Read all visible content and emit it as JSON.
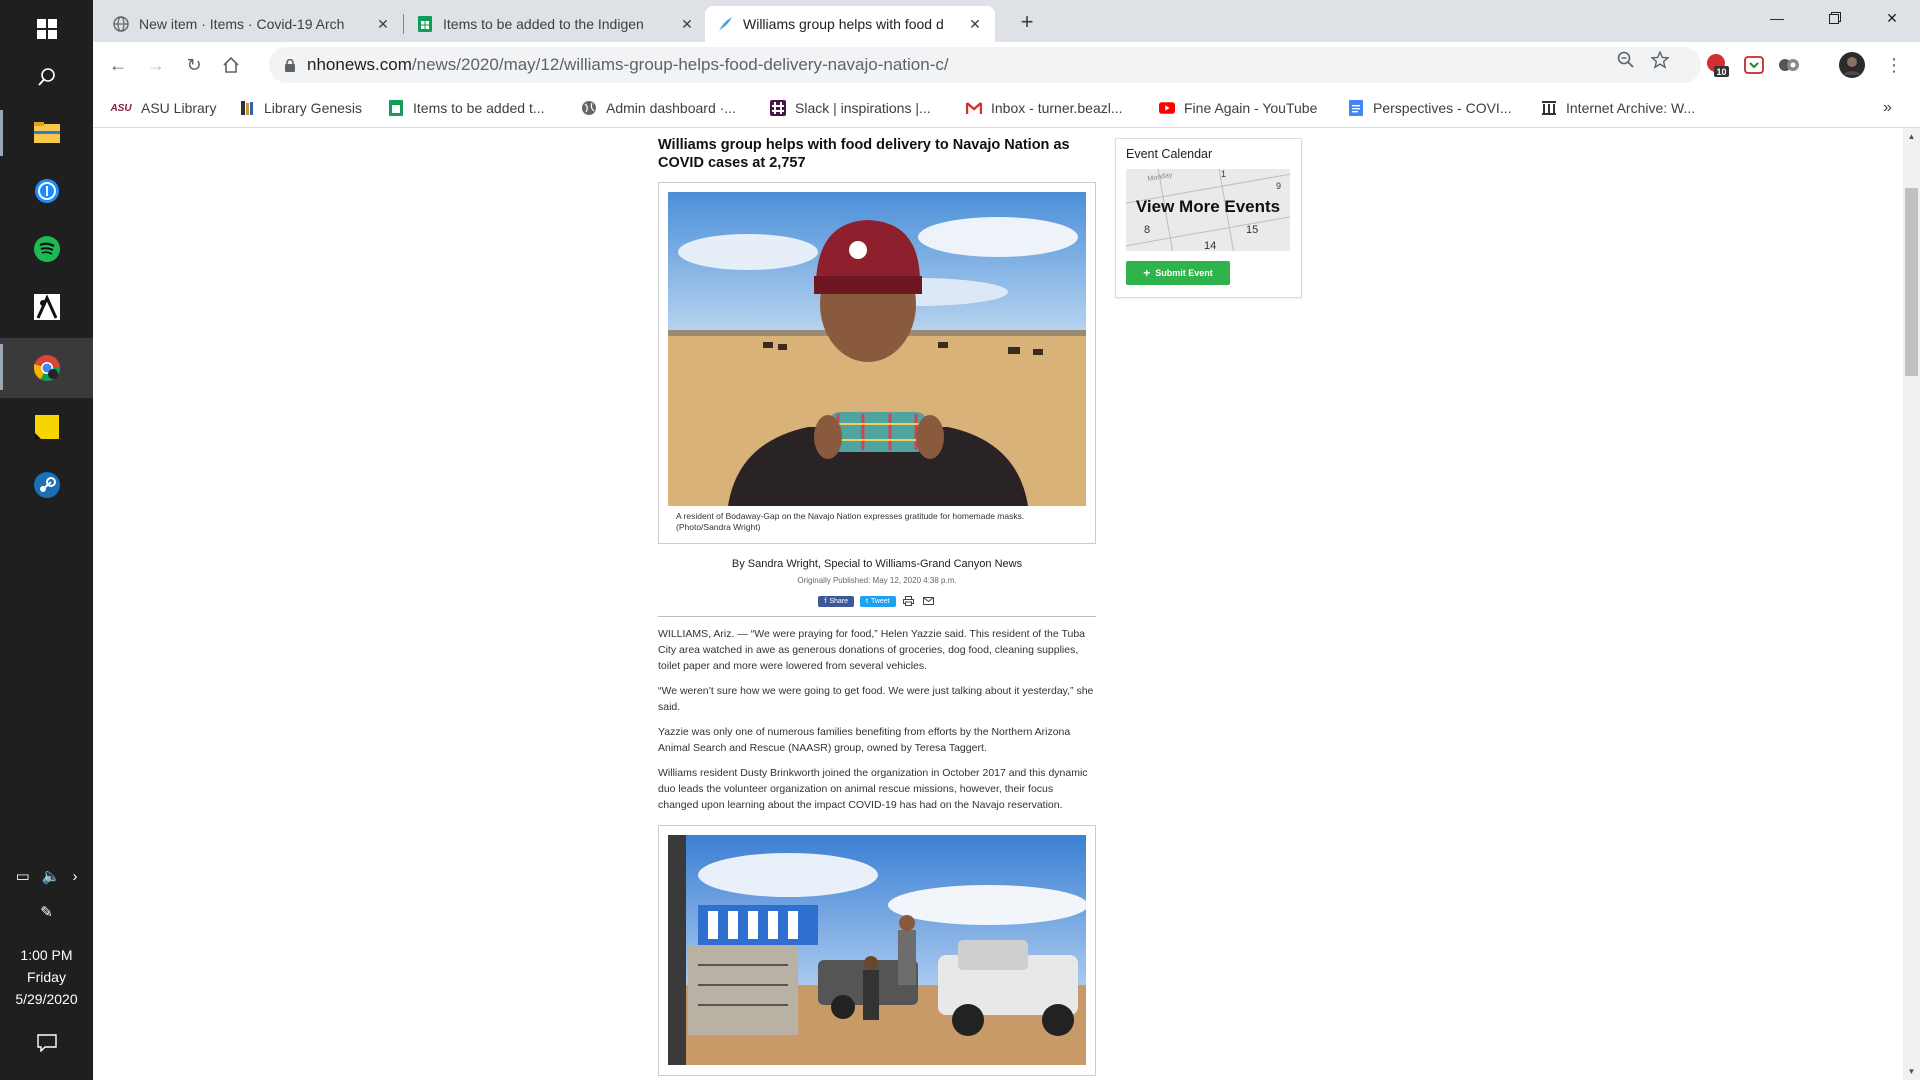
{
  "taskbar": {
    "time": "1:00 PM",
    "day": "Friday",
    "date": "5/29/2020"
  },
  "tabs": [
    {
      "title": "New item · Items · Covid-19 Arch",
      "icon": "globe-icon"
    },
    {
      "title": "Items to be added to the Indigen",
      "icon": "sheets-icon"
    },
    {
      "title": "Williams group helps with food d",
      "icon": "quill-icon"
    }
  ],
  "toolbar": {
    "url_host": "nhonews.com",
    "url_path": "/news/2020/may/12/williams-group-helps-food-delivery-navajo-nation-c/",
    "ext_badge": "10"
  },
  "bookmarks": [
    {
      "label": "ASU Library",
      "icon": "asu-icon"
    },
    {
      "label": "Library Genesis",
      "icon": "library-icon"
    },
    {
      "label": "Items to be added t...",
      "icon": "sheets-icon"
    },
    {
      "label": "Admin dashboard ·...",
      "icon": "globe-icon"
    },
    {
      "label": "Slack | inspirations |...",
      "icon": "slack-icon"
    },
    {
      "label": "Inbox - turner.beazl...",
      "icon": "gmail-icon"
    },
    {
      "label": "Fine Again - YouTube",
      "icon": "youtube-icon"
    },
    {
      "label": "Perspectives - COVI...",
      "icon": "docs-icon"
    },
    {
      "label": "Internet Archive: W...",
      "icon": "archive-icon"
    }
  ],
  "article": {
    "headline": "Williams group helps with food delivery to Navajo Nation as COVID cases at 2,757",
    "photo1_caption": "A resident of Bodaway-Gap on the Navajo Nation expresses gratitude for homemade masks. (Photo/Sandra Wright)",
    "byline": "By Sandra Wright, Special to Williams-Grand Canyon News",
    "published": "Originally Published: May 12, 2020 4:38 p.m.",
    "share_fb": "Share",
    "share_tw": "Tweet",
    "paragraphs": [
      "WILLIAMS, Ariz. — “We were praying for food,” Helen Yazzie said. This resident of the Tuba City area watched in awe as generous donations of groceries, dog food, cleaning supplies, toilet paper and more were lowered from several vehicles.",
      "“We weren’t sure how we were going to get food. We were just talking about it yesterday,” she said.",
      "Yazzie was only one of numerous families benefiting from efforts by the Northern Arizona Animal Search and Rescue (NAASR) group, owned by Teresa Taggert.",
      "Williams resident Dusty Brinkworth joined the organization in October 2017 and this dynamic duo leads the volunteer organization on animal rescue missions, however, their focus changed upon learning about the impact COVID-19 has had on the Navajo reservation."
    ]
  },
  "sidebar": {
    "title": "Event Calendar",
    "view_more": "View More Events",
    "submit": "Submit Event",
    "cal_words": [
      "Monday",
      "1",
      "9",
      "8",
      "14",
      "15"
    ]
  },
  "colors": {
    "taskbar_bg": "#1f1f1f",
    "tabstrip_bg": "#dee1e6",
    "submit_green": "#2fb34a",
    "facebook_blue": "#3b5998",
    "twitter_blue": "#1da1f2"
  }
}
